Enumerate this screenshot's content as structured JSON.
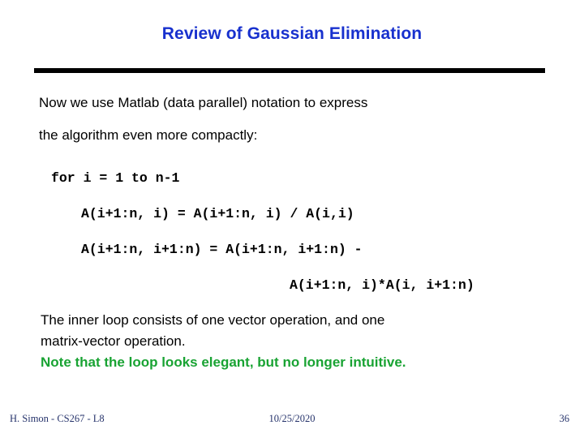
{
  "slide": {
    "title": "Review of Gaussian Elimination",
    "title_color": "#1831CE",
    "rule_color": "#000000",
    "background": "#ffffff"
  },
  "intro": {
    "line1": "Now we use Matlab (data parallel) notation to express",
    "line2": "the algorithm even more compactly:"
  },
  "code": {
    "lines": [
      "for i = 1 to n-1",
      "A(i+1:n, i) = A(i+1:n, i) / A(i,i)",
      "A(i+1:n, i+1:n) = A(i+1:n, i+1:n) -",
      "A(i+1:n, i)*A(i, i+1:n)"
    ]
  },
  "closing": {
    "line1": "The inner loop consists of one vector operation, and one",
    "line2": "matrix-vector operation.",
    "line3": "Note that the loop looks elegant, but no longer intuitive.",
    "highlight_color": "#19A333"
  },
  "footer": {
    "author": "H. Simon - CS267 - L8",
    "date": "10/25/2020",
    "page_number": "36",
    "color": "#26336B"
  }
}
